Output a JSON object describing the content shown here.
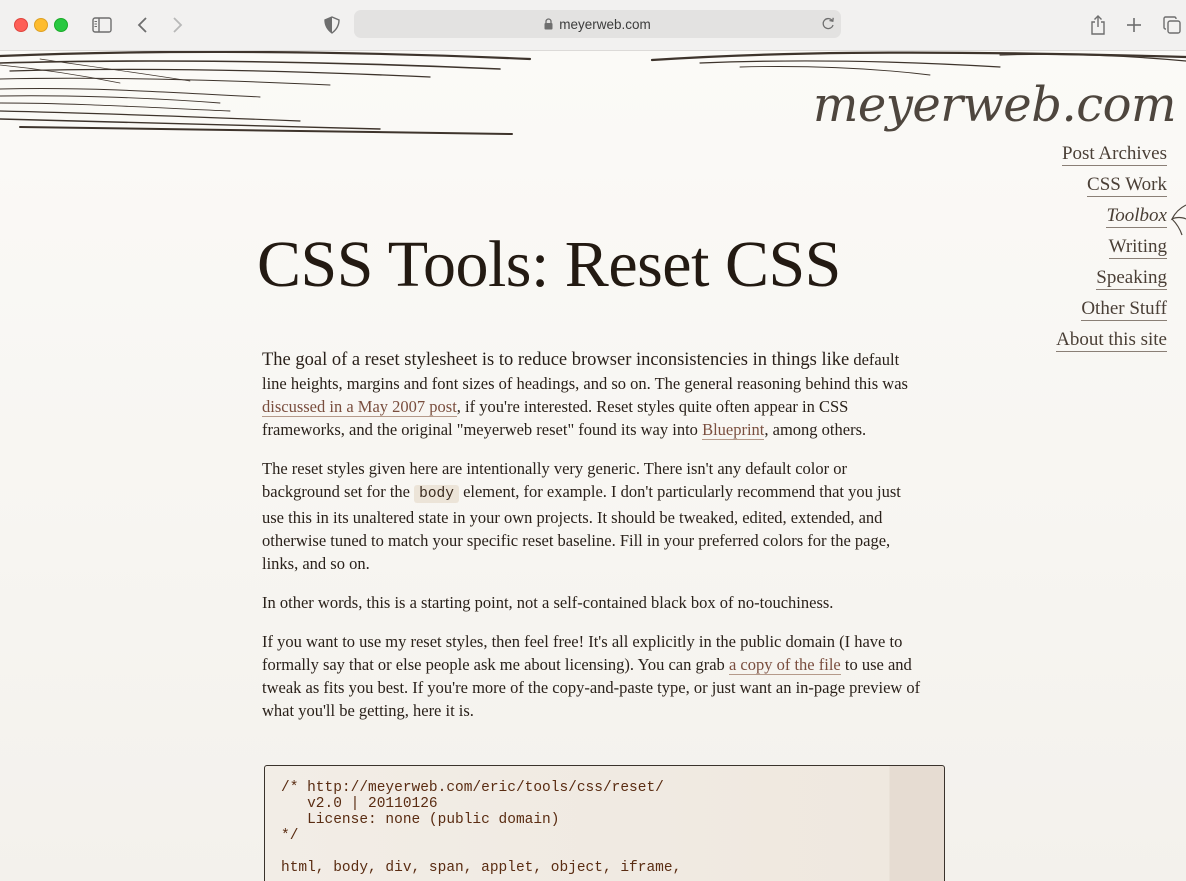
{
  "browser": {
    "url": "meyerweb.com"
  },
  "site": {
    "logo": "meyerweb.com",
    "nav": [
      {
        "label": "Post Archives"
      },
      {
        "label": "CSS Work"
      },
      {
        "label": "Toolbox"
      },
      {
        "label": "Writing"
      },
      {
        "label": "Speaking"
      },
      {
        "label": "Other Stuff"
      },
      {
        "label": "About this site"
      }
    ]
  },
  "article": {
    "title": "CSS Tools: Reset CSS",
    "p1": {
      "lead": "The goal of a reset stylesheet is to reduce browser inconsistencies in things like",
      "text_a": " default line heights, margins and font sizes of headings, and so on. The general reasoning behind this was ",
      "link1": "discussed in a May 2007 post",
      "text_b": ", if you're interested. Reset styles quite often appear in CSS frameworks, and the original \"meyerweb reset\" found its way into ",
      "link2": "Blueprint",
      "text_c": ", among others."
    },
    "p2": {
      "text_a": "The reset styles given here are intentionally very generic. There isn't any default color or background set for the ",
      "code": "body",
      "text_b": " element, for example. I don't particularly recommend that you just use this in its unaltered state in your own projects. It should be tweaked, edited, extended, and otherwise tuned to match your specific reset baseline. Fill in your preferred colors for the page, links, and so on."
    },
    "p3": "In other words, this is a starting point, not a self-contained black box of no-touchiness.",
    "p4": {
      "text_a": "If you want to use my reset styles, then feel free! It's all explicitly in the public domain (I have to formally say that or else people ask me about licensing). You can grab ",
      "link": "a copy of the file",
      "text_b": " to use and tweak as fits you best. If you're more of the copy-and-paste type, or just want an in-page preview of what you'll be getting, here it is."
    },
    "code_block": "/* http://meyerweb.com/eric/tools/css/reset/\n   v2.0 | 20110126\n   License: none (public domain)\n*/\n\nhtml, body, div, span, applet, object, iframe,"
  }
}
